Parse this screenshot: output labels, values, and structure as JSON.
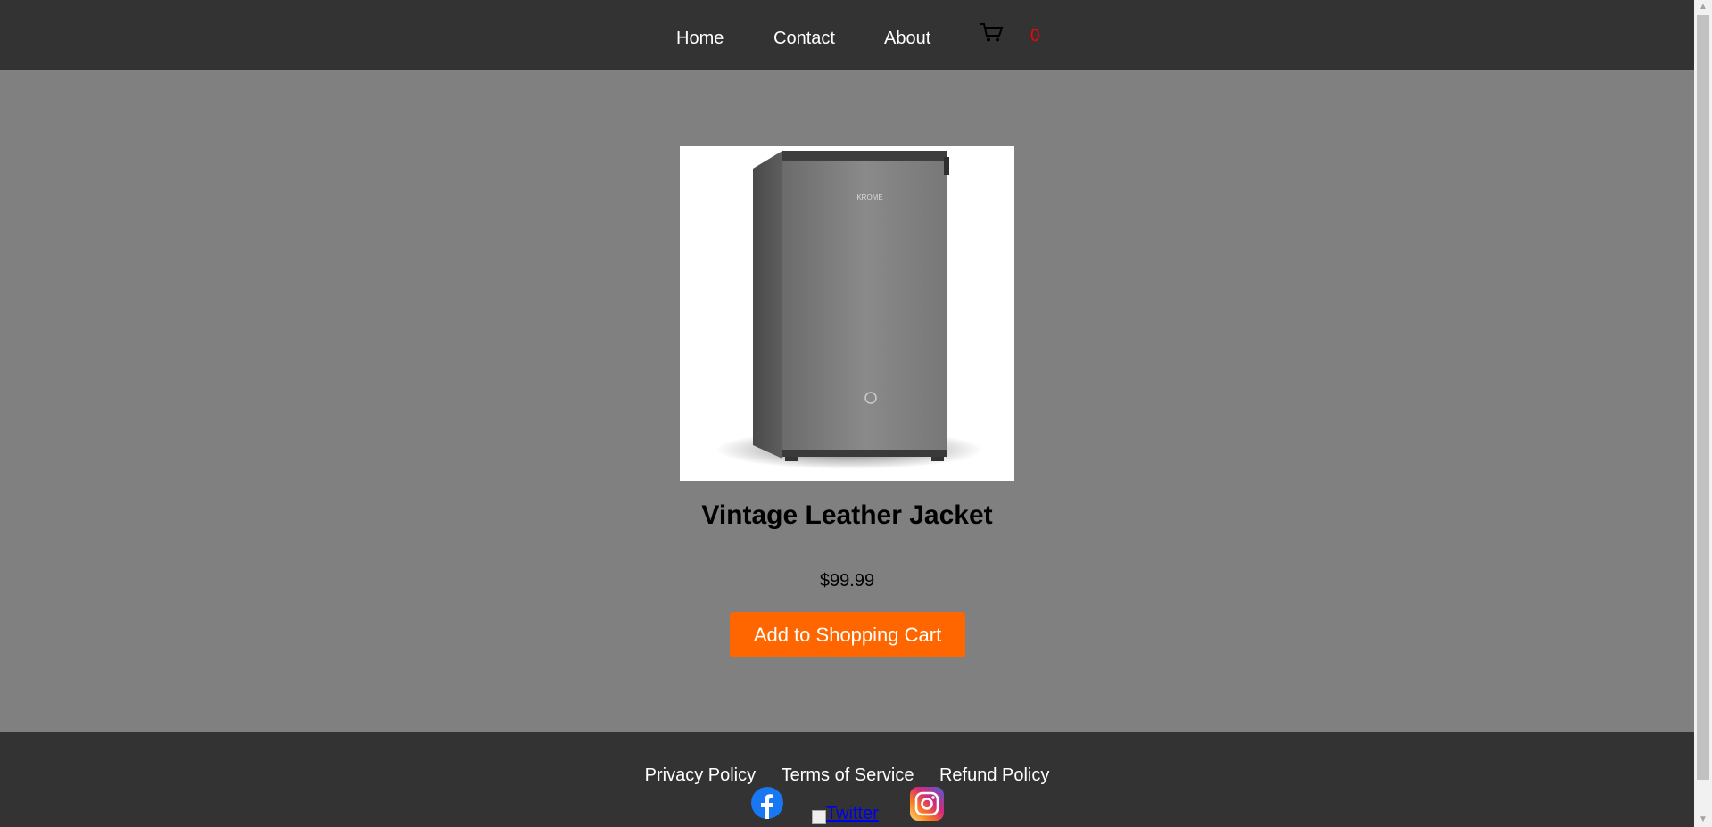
{
  "nav": {
    "links": [
      {
        "label": "Home"
      },
      {
        "label": "Contact"
      },
      {
        "label": "About"
      }
    ],
    "cart_icon": "shopping-cart-icon",
    "cart_count": "0",
    "cart_count_color": "#ff0000"
  },
  "product": {
    "image": "refrigerator-image",
    "title": "Vintage Leather Jacket",
    "price": "$99.99",
    "add_button_label": "Add to Shopping Cart"
  },
  "footer": {
    "links": [
      {
        "label": "Privacy Policy"
      },
      {
        "label": "Terms of Service"
      },
      {
        "label": "Refund Policy"
      }
    ],
    "social": {
      "facebook_icon": "facebook-icon",
      "twitter_alt": "Twitter",
      "instagram_icon": "instagram-icon"
    }
  },
  "colors": {
    "nav_bg": "#333333",
    "page_bg": "#808080",
    "accent_button": "#ff6600",
    "footer_bg": "#333333"
  }
}
